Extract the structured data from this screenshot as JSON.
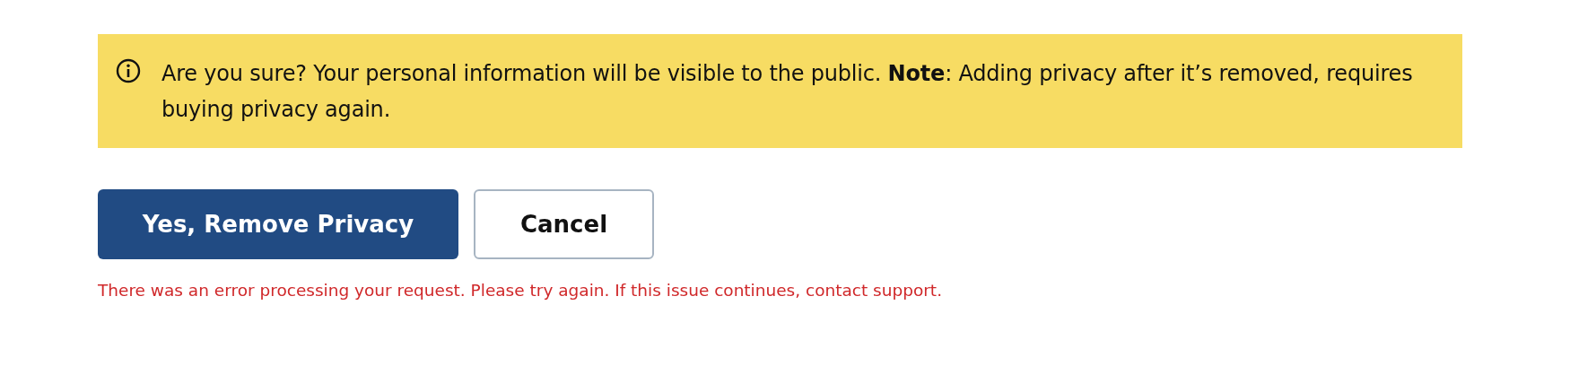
{
  "alert": {
    "message": "Are you sure? Your personal information will be visible to the public. **Note**: Adding privacy after it’s removed, requires buying privacy again."
  },
  "buttons": [
    {
      "label": "Yes, Remove Privacy",
      "kind": "primary"
    },
    {
      "label": "Cancel",
      "kind": "secondary"
    }
  ],
  "error": "There was an error processing your request. Please try again. If this issue continues, contact support."
}
